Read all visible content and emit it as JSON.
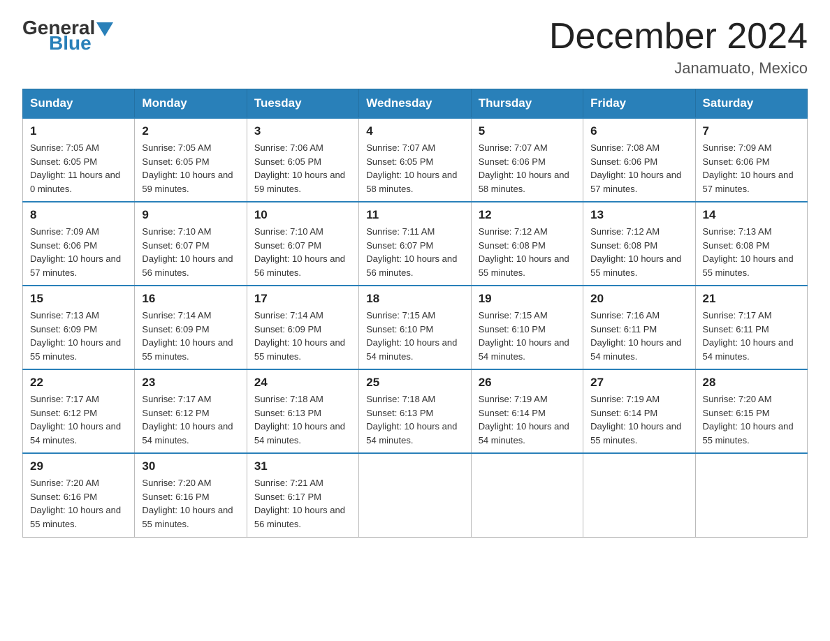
{
  "logo": {
    "general": "General",
    "blue": "Blue"
  },
  "title": "December 2024",
  "subtitle": "Janamuato, Mexico",
  "days_header": [
    "Sunday",
    "Monday",
    "Tuesday",
    "Wednesday",
    "Thursday",
    "Friday",
    "Saturday"
  ],
  "weeks": [
    [
      {
        "day": "1",
        "sunrise": "7:05 AM",
        "sunset": "6:05 PM",
        "daylight": "11 hours and 0 minutes."
      },
      {
        "day": "2",
        "sunrise": "7:05 AM",
        "sunset": "6:05 PM",
        "daylight": "10 hours and 59 minutes."
      },
      {
        "day": "3",
        "sunrise": "7:06 AM",
        "sunset": "6:05 PM",
        "daylight": "10 hours and 59 minutes."
      },
      {
        "day": "4",
        "sunrise": "7:07 AM",
        "sunset": "6:05 PM",
        "daylight": "10 hours and 58 minutes."
      },
      {
        "day": "5",
        "sunrise": "7:07 AM",
        "sunset": "6:06 PM",
        "daylight": "10 hours and 58 minutes."
      },
      {
        "day": "6",
        "sunrise": "7:08 AM",
        "sunset": "6:06 PM",
        "daylight": "10 hours and 57 minutes."
      },
      {
        "day": "7",
        "sunrise": "7:09 AM",
        "sunset": "6:06 PM",
        "daylight": "10 hours and 57 minutes."
      }
    ],
    [
      {
        "day": "8",
        "sunrise": "7:09 AM",
        "sunset": "6:06 PM",
        "daylight": "10 hours and 57 minutes."
      },
      {
        "day": "9",
        "sunrise": "7:10 AM",
        "sunset": "6:07 PM",
        "daylight": "10 hours and 56 minutes."
      },
      {
        "day": "10",
        "sunrise": "7:10 AM",
        "sunset": "6:07 PM",
        "daylight": "10 hours and 56 minutes."
      },
      {
        "day": "11",
        "sunrise": "7:11 AM",
        "sunset": "6:07 PM",
        "daylight": "10 hours and 56 minutes."
      },
      {
        "day": "12",
        "sunrise": "7:12 AM",
        "sunset": "6:08 PM",
        "daylight": "10 hours and 55 minutes."
      },
      {
        "day": "13",
        "sunrise": "7:12 AM",
        "sunset": "6:08 PM",
        "daylight": "10 hours and 55 minutes."
      },
      {
        "day": "14",
        "sunrise": "7:13 AM",
        "sunset": "6:08 PM",
        "daylight": "10 hours and 55 minutes."
      }
    ],
    [
      {
        "day": "15",
        "sunrise": "7:13 AM",
        "sunset": "6:09 PM",
        "daylight": "10 hours and 55 minutes."
      },
      {
        "day": "16",
        "sunrise": "7:14 AM",
        "sunset": "6:09 PM",
        "daylight": "10 hours and 55 minutes."
      },
      {
        "day": "17",
        "sunrise": "7:14 AM",
        "sunset": "6:09 PM",
        "daylight": "10 hours and 55 minutes."
      },
      {
        "day": "18",
        "sunrise": "7:15 AM",
        "sunset": "6:10 PM",
        "daylight": "10 hours and 54 minutes."
      },
      {
        "day": "19",
        "sunrise": "7:15 AM",
        "sunset": "6:10 PM",
        "daylight": "10 hours and 54 minutes."
      },
      {
        "day": "20",
        "sunrise": "7:16 AM",
        "sunset": "6:11 PM",
        "daylight": "10 hours and 54 minutes."
      },
      {
        "day": "21",
        "sunrise": "7:17 AM",
        "sunset": "6:11 PM",
        "daylight": "10 hours and 54 minutes."
      }
    ],
    [
      {
        "day": "22",
        "sunrise": "7:17 AM",
        "sunset": "6:12 PM",
        "daylight": "10 hours and 54 minutes."
      },
      {
        "day": "23",
        "sunrise": "7:17 AM",
        "sunset": "6:12 PM",
        "daylight": "10 hours and 54 minutes."
      },
      {
        "day": "24",
        "sunrise": "7:18 AM",
        "sunset": "6:13 PM",
        "daylight": "10 hours and 54 minutes."
      },
      {
        "day": "25",
        "sunrise": "7:18 AM",
        "sunset": "6:13 PM",
        "daylight": "10 hours and 54 minutes."
      },
      {
        "day": "26",
        "sunrise": "7:19 AM",
        "sunset": "6:14 PM",
        "daylight": "10 hours and 54 minutes."
      },
      {
        "day": "27",
        "sunrise": "7:19 AM",
        "sunset": "6:14 PM",
        "daylight": "10 hours and 55 minutes."
      },
      {
        "day": "28",
        "sunrise": "7:20 AM",
        "sunset": "6:15 PM",
        "daylight": "10 hours and 55 minutes."
      }
    ],
    [
      {
        "day": "29",
        "sunrise": "7:20 AM",
        "sunset": "6:16 PM",
        "daylight": "10 hours and 55 minutes."
      },
      {
        "day": "30",
        "sunrise": "7:20 AM",
        "sunset": "6:16 PM",
        "daylight": "10 hours and 55 minutes."
      },
      {
        "day": "31",
        "sunrise": "7:21 AM",
        "sunset": "6:17 PM",
        "daylight": "10 hours and 56 minutes."
      },
      null,
      null,
      null,
      null
    ]
  ]
}
